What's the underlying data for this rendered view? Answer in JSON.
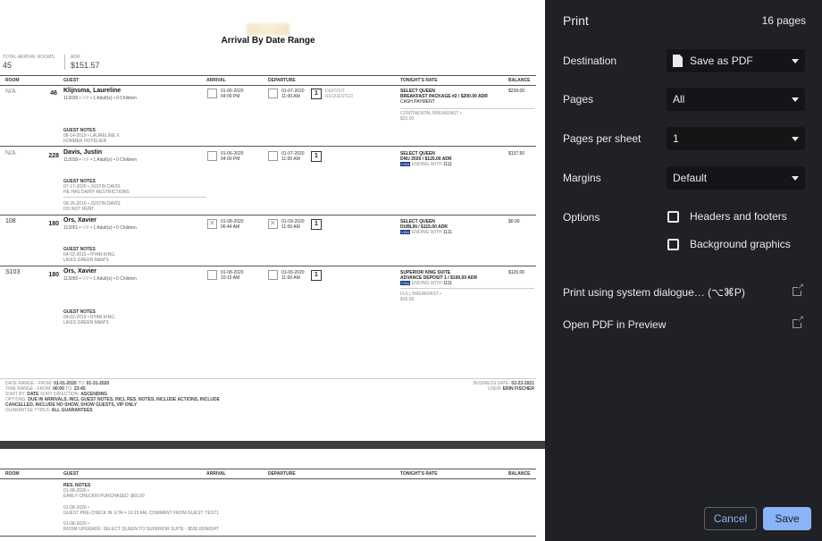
{
  "report": {
    "title": "Arrival By Date Range",
    "total_arrival_rooms_label": "Total Arrival Rooms",
    "total_arrival_rooms": "45",
    "adr_label": "ADR",
    "adr": "$151.57",
    "columns": {
      "room": "Room",
      "guest": "Guest",
      "arrival": "Arrival",
      "departure": "Departure",
      "rate": "Tonight's Rate",
      "balance": "Balance"
    },
    "rows": [
      {
        "room": "N/A",
        "rooms": "46",
        "guest": "Klijnsma, Laureline",
        "guest_id": "113035",
        "vip": "VIP",
        "occupancy": "1 Adult(s) • 0 Children",
        "arrival_date": "01-06-2020",
        "arrival_time": "04:00 PM",
        "departure_date": "01-07-2020",
        "departure_time": "11:00 AM",
        "nights": "1",
        "deposit_1": "Deposit",
        "deposit_2": "Requested",
        "rate_1": "Select Queen",
        "rate_2": "Breakfast Package #2 / $200.00 ADR",
        "rate_3": "Cash Payment",
        "rate_4": "Continental Breakfast •",
        "rate_5": "$20.00",
        "balance": "$239.00",
        "notes_header": "Guest Notes",
        "notes": [
          "08-14-2019 • Laureline X",
          "Former Hotelier"
        ]
      },
      {
        "room": "N/A",
        "rooms": "228",
        "guest": "Davis, Justin",
        "guest_id": "113039",
        "vip": "VIP",
        "occupancy": "1 Adult(s) • 0 Children",
        "arrival_date": "01-06-2020",
        "arrival_time": "04:00 PM",
        "departure_date": "01-07-2020",
        "departure_time": "11:00 AM",
        "nights": "1",
        "rate_1": "Select Queen",
        "rate_2": "DNU 2020 / $125.00 ADR",
        "rate_3": "Ending with",
        "rate_3b": "1111",
        "balance": "$137.50",
        "notes_header": "Guest Notes",
        "notes": [
          "07-17-2020 • Justin Davis",
          "He has dairy restrictions",
          "09-26-2019 • Justin Davis",
          "Do not rent"
        ]
      },
      {
        "room": "108",
        "rooms": "180",
        "guest": "Ors, Xavier",
        "guest_id": "113051",
        "vip": "VIP",
        "occupancy": "1 Adult(s) • 0 Children",
        "arrival_date": "01-08-2020",
        "arrival_time": "06:44 AM",
        "departure_date": "01-09-2020",
        "departure_time": "11:00 AM",
        "nights": "1",
        "rate_1": "Select Queen",
        "rate_2": "Dublin / $115.00 ADR",
        "rate_3": "Ending with",
        "rate_3b": "1111",
        "balance": "$0.00",
        "notes_header": "Guest Notes",
        "notes": [
          "04-02-2019 • Ryan King",
          "Likes green M&M's"
        ]
      },
      {
        "room": "S103",
        "rooms": "180",
        "guest": "Ors, Xavier",
        "guest_id": "113050",
        "vip": "VIP",
        "occupancy": "1 Adult(s) • 0 Children",
        "arrival_date": "01-08-2020",
        "arrival_time": "10:15 AM",
        "departure_date": "01-09-2020",
        "departure_time": "11:00 AM",
        "nights": "1",
        "rate_1": "Superior King Suite",
        "rate_2": "Advance Deposit 1 / $100.00 ADR",
        "rate_3": "Ending with",
        "rate_3b": "1111",
        "rate_4": "Full Breakfast •",
        "rate_5": "$35.00",
        "balance": "$120.00",
        "notes_header": "Guest Notes",
        "notes": [
          "04-02-2019 • Ryan King",
          "Likes green M&M's"
        ]
      }
    ],
    "footer": {
      "date_range_k": "Date Range - From:",
      "date_range_from": "01-01-2020",
      "date_range_to_k": "To:",
      "date_range_to": "01-31-2020",
      "time_range_k": "Time Range - From:",
      "time_range_from": "00:00",
      "time_range_to_k": "To:",
      "time_range_to": "23:45",
      "sort_k": "Sort By:",
      "sort_by": "Date",
      "sort_dir_k": "Sort Direction:",
      "sort_dir": "Ascending",
      "options_k": "Options:",
      "options_1": "Due in Arrivals, Incl Guest Notes, Incl Res. Notes, Include Actions, Include",
      "options_2": "Cancelled, Include No Show, Show Guests, VIP Only",
      "guarantee_k": "Guarantee Types:",
      "guarantee": "All Guarantees",
      "business_date_k": "Business Date:",
      "business_date": "02-23-2021",
      "user_k": "User:",
      "user": "Erin Fischer"
    },
    "page2": {
      "res_notes_header": "Res. Notes",
      "notes": [
        "01-08-2020 •",
        "Early Checkin Purchased: $60.00",
        "01-08-2020 •",
        "Guest Pre-Check In: ETA = 10:15 AM. Comment from Guest: test1",
        "01-08-2020 •",
        "Room Upgrade: Select Queen to Superior Suite - $530.00/night"
      ]
    }
  },
  "panel": {
    "title": "Print",
    "page_count": "16 pages",
    "destination_label": "Destination",
    "destination_value": "Save as PDF",
    "pages_label": "Pages",
    "pages_value": "All",
    "pages_per_sheet_label": "Pages per sheet",
    "pages_per_sheet_value": "1",
    "margins_label": "Margins",
    "margins_value": "Default",
    "options_label": "Options",
    "option_headers": "Headers and footers",
    "option_background": "Background graphics",
    "system_dialog": "Print using system dialogue… (⌥⌘P)",
    "open_pdf": "Open PDF in Preview",
    "cancel": "Cancel",
    "save": "Save"
  },
  "colors": {
    "panel_bg": "#202124",
    "accent": "#8ab4f8",
    "select_bg": "#141517"
  }
}
